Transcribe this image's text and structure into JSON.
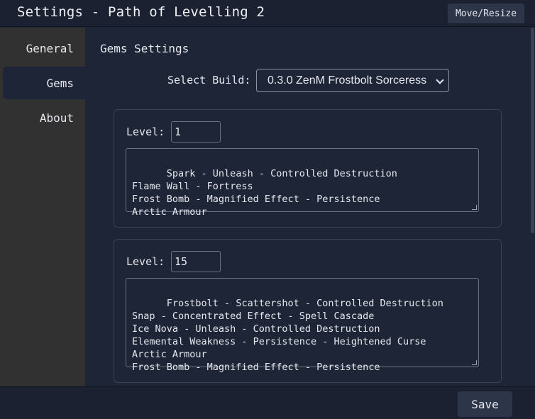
{
  "window": {
    "title": "Settings - Path of Levelling 2",
    "move_resize_label": "Move/Resize"
  },
  "sidebar": {
    "items": [
      {
        "label": "General",
        "active": false
      },
      {
        "label": "Gems",
        "active": true
      },
      {
        "label": "About",
        "active": false
      }
    ]
  },
  "main": {
    "section_title": "Gems Settings",
    "build": {
      "label": "Select Build:",
      "selected": "0.3.0 ZenM Frostbolt Sorceress"
    },
    "gem_sets": [
      {
        "level_label": "Level:",
        "level": "1",
        "gems": "Spark - Unleash - Controlled Destruction\nFlame Wall - Fortress\nFrost Bomb - Magnified Effect - Persistence\nArctic Armour"
      },
      {
        "level_label": "Level:",
        "level": "15",
        "gems": "Frostbolt - Scattershot - Controlled Destruction\nSnap - Concentrated Effect - Spell Cascade\nIce Nova - Unleash - Controlled Destruction\nElemental Weakness - Persistence - Heightened Curse\nArctic Armour\nFrost Bomb - Magnified Effect - Persistence"
      }
    ]
  },
  "footer": {
    "save_label": "Save"
  }
}
